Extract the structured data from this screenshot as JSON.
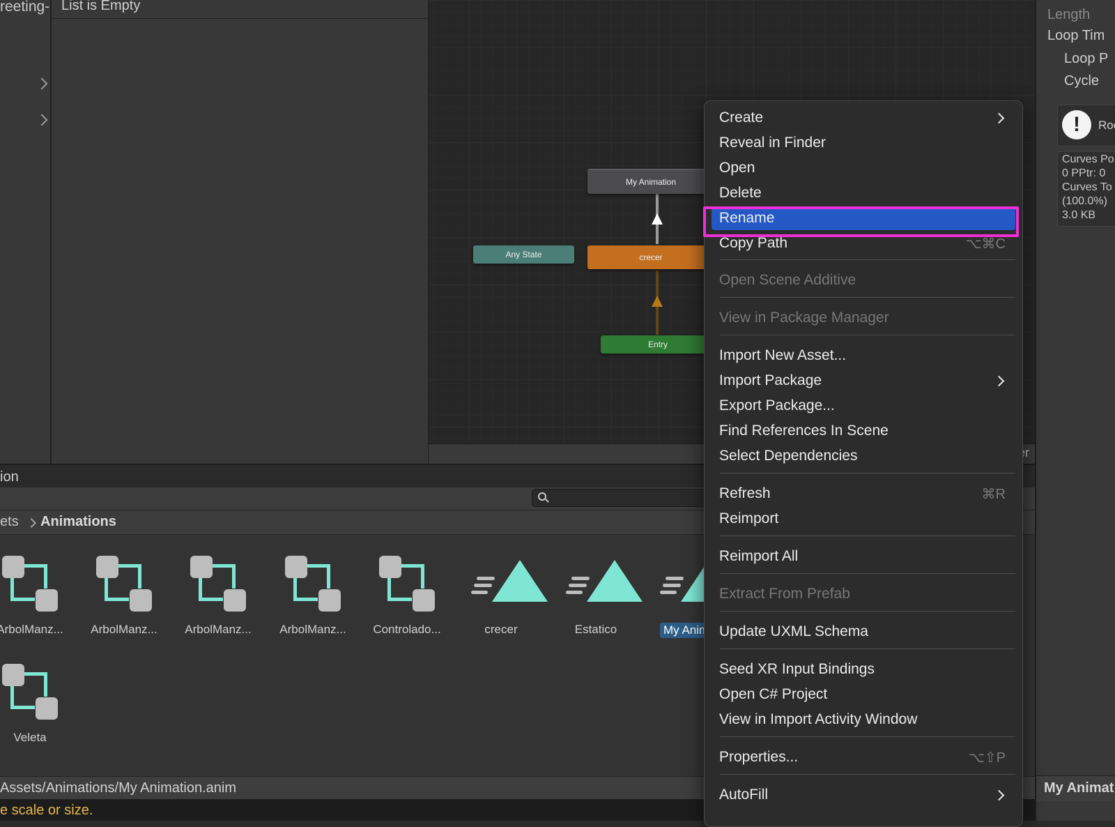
{
  "left_panel": {
    "label": "reeting-"
  },
  "list_panel": {
    "header": "List is Empty"
  },
  "graph": {
    "nodes": {
      "my_animation": "My Animation",
      "any_state": "Any State",
      "crecer": "crecer",
      "entry": "Entry"
    },
    "footer_text": "er"
  },
  "inspector": {
    "length": "Length",
    "loop_time": "Loop Tim",
    "loop_pose": "Loop P",
    "cycle": "Cycle",
    "warning_text": "Roo",
    "stats": [
      "Curves Po",
      "0 PPtr: 0",
      "Curves To",
      "(100.0%)",
      "3.0 KB"
    ],
    "bottom_title": "My Animat"
  },
  "project": {
    "title": "ion",
    "toolbar_count": "6",
    "breadcrumb": {
      "parent": "ets",
      "current": "Animations"
    },
    "assets": [
      {
        "label": "ArbolManz...",
        "icon": "animator-controller-icon"
      },
      {
        "label": "ArbolManz...",
        "icon": "animator-controller-icon"
      },
      {
        "label": "ArbolManz...",
        "icon": "animator-controller-icon"
      },
      {
        "label": "ArbolManz...",
        "icon": "animator-controller-icon"
      },
      {
        "label": "Controlado...",
        "icon": "animator-controller-icon"
      },
      {
        "label": "crecer",
        "icon": "animation-clip-icon"
      },
      {
        "label": "Estatico",
        "icon": "animation-clip-icon"
      },
      {
        "label": "My Anim",
        "icon": "animation-clip-icon",
        "selected": true
      },
      {
        "label": "Veleta",
        "icon": "animator-controller-icon"
      }
    ],
    "path": "Assets/Animations/My Animation.anim",
    "console_message": "e scale or size."
  },
  "context_menu": {
    "items": [
      {
        "label": "Create",
        "submenu": true
      },
      {
        "label": "Reveal in Finder"
      },
      {
        "label": "Open"
      },
      {
        "label": "Delete"
      },
      {
        "label": "Rename",
        "active": true
      },
      {
        "label": "Copy Path",
        "shortcut": "⌥⌘C"
      },
      {
        "label": "Open Scene Additive",
        "disabled": true
      },
      {
        "label": "View in Package Manager",
        "disabled": true
      },
      {
        "label": "Import New Asset..."
      },
      {
        "label": "Import Package",
        "submenu": true
      },
      {
        "label": "Export Package..."
      },
      {
        "label": "Find References In Scene"
      },
      {
        "label": "Select Dependencies"
      },
      {
        "label": "Refresh",
        "shortcut": "⌘R"
      },
      {
        "label": "Reimport"
      },
      {
        "label": "Reimport All"
      },
      {
        "label": "Extract From Prefab",
        "disabled": true
      },
      {
        "label": "Update UXML Schema"
      },
      {
        "label": "Seed XR Input Bindings"
      },
      {
        "label": "Open C# Project"
      },
      {
        "label": "View in Import Activity Window"
      },
      {
        "label": "Properties...",
        "shortcut": "⌥⇧P"
      },
      {
        "label": "AutoFill",
        "submenu": true
      }
    ]
  },
  "colors": {
    "menu_active": "#2459c5",
    "highlight_outline": "#ee2ed7",
    "animation_accent": "#7ee6d2",
    "crecer_node": "#c46f1f",
    "entry_node": "#2e7b33",
    "any_state_node": "#4c7e78"
  }
}
